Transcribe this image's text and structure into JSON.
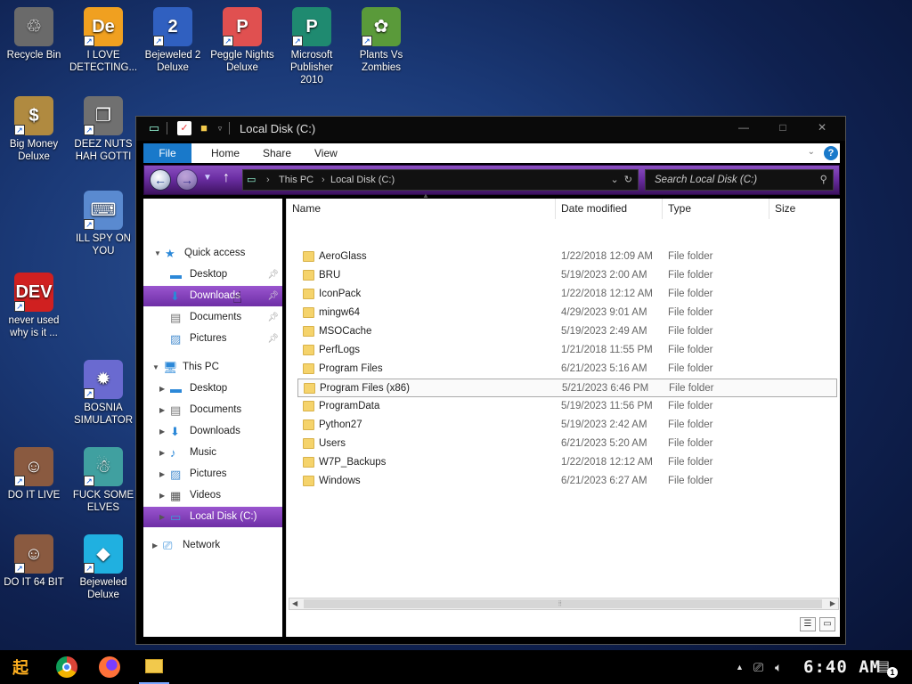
{
  "desktop": {
    "icons": [
      {
        "label": "Recycle Bin",
        "glyph": "♲",
        "color": "#6a6a6a"
      },
      {
        "label": "I LOVE DETECTING...",
        "glyph": "De",
        "color": "#f0a020"
      },
      {
        "label": "Bejeweled 2 Deluxe",
        "glyph": "2",
        "color": "#3060c0"
      },
      {
        "label": "Peggle Nights Deluxe",
        "glyph": "P",
        "color": "#e05050"
      },
      {
        "label": "Microsoft Publisher 2010",
        "glyph": "P",
        "color": "#1f8a70"
      },
      {
        "label": "Plants Vs Zombies",
        "glyph": "✿",
        "color": "#5a9a3a"
      },
      {
        "label": "Big Money Deluxe",
        "glyph": "$",
        "color": "#b08a40"
      },
      {
        "label": "DEEZ NUTS HAH GOTTI",
        "glyph": "❐",
        "color": "#707070"
      },
      {
        "label": "ILL SPY ON YOU",
        "glyph": "⌨",
        "color": "#5a8ad0"
      },
      {
        "label": "never used why is it ...",
        "glyph": "DEV",
        "color": "#d02020"
      },
      {
        "label": "BOSNIA SIMULATOR",
        "glyph": "✹",
        "color": "#6a6ad0"
      },
      {
        "label": "DO IT LIVE",
        "glyph": "☺",
        "color": "#8a5a40"
      },
      {
        "label": "FUCK SOME ELVES",
        "glyph": "☃",
        "color": "#40a0a0"
      },
      {
        "label": "DO IT 64 BIT",
        "glyph": "☺",
        "color": "#8a5a40"
      },
      {
        "label": "Bejeweled Deluxe",
        "glyph": "◆",
        "color": "#20b0e0"
      }
    ]
  },
  "window": {
    "title": "Local Disk (C:)",
    "controls": {
      "minimize": "—",
      "maximize": "□",
      "close": "✕"
    },
    "ribbon": {
      "file": "File",
      "home": "Home",
      "share": "Share",
      "view": "View",
      "help": "?"
    },
    "address": {
      "crumbs": [
        "This PC",
        "Local Disk (C:)"
      ],
      "separator": "›"
    },
    "search_placeholder": "Search Local Disk (C:)",
    "nav": {
      "quick_access": "Quick access",
      "quick_items": [
        {
          "label": "Desktop"
        },
        {
          "label": "Downloads",
          "selected": true
        },
        {
          "label": "Documents"
        },
        {
          "label": "Pictures"
        }
      ],
      "this_pc": "This PC",
      "pc_items": [
        {
          "label": "Desktop"
        },
        {
          "label": "Documents"
        },
        {
          "label": "Downloads"
        },
        {
          "label": "Music"
        },
        {
          "label": "Pictures"
        },
        {
          "label": "Videos"
        },
        {
          "label": "Local Disk (C:)",
          "selected": true
        }
      ],
      "network": "Network"
    },
    "columns": {
      "name": "Name",
      "date": "Date modified",
      "type": "Type",
      "size": "Size"
    },
    "files": [
      {
        "name": "AeroGlass",
        "date": "1/22/2018 12:09 AM",
        "type": "File folder"
      },
      {
        "name": "BRU",
        "date": "5/19/2023 2:00 AM",
        "type": "File folder"
      },
      {
        "name": "IconPack",
        "date": "1/22/2018 12:12 AM",
        "type": "File folder"
      },
      {
        "name": "mingw64",
        "date": "4/29/2023 9:01 AM",
        "type": "File folder"
      },
      {
        "name": "MSOCache",
        "date": "5/19/2023 2:49 AM",
        "type": "File folder"
      },
      {
        "name": "PerfLogs",
        "date": "1/21/2018 11:55 PM",
        "type": "File folder"
      },
      {
        "name": "Program Files",
        "date": "6/21/2023 5:16 AM",
        "type": "File folder"
      },
      {
        "name": "Program Files (x86)",
        "date": "5/21/2023 6:46 PM",
        "type": "File folder",
        "selected": true
      },
      {
        "name": "ProgramData",
        "date": "5/19/2023 11:56 PM",
        "type": "File folder"
      },
      {
        "name": "Python27",
        "date": "5/19/2023 2:42 AM",
        "type": "File folder"
      },
      {
        "name": "Users",
        "date": "6/21/2023 5:20 AM",
        "type": "File folder"
      },
      {
        "name": "W7P_Backups",
        "date": "1/22/2018 12:12 AM",
        "type": "File folder"
      },
      {
        "name": "Windows",
        "date": "6/21/2023 6:27 AM",
        "type": "File folder"
      }
    ]
  },
  "taskbar": {
    "clock": "6:40 AM",
    "notification_count": "1",
    "tray_chevron": "▲"
  }
}
